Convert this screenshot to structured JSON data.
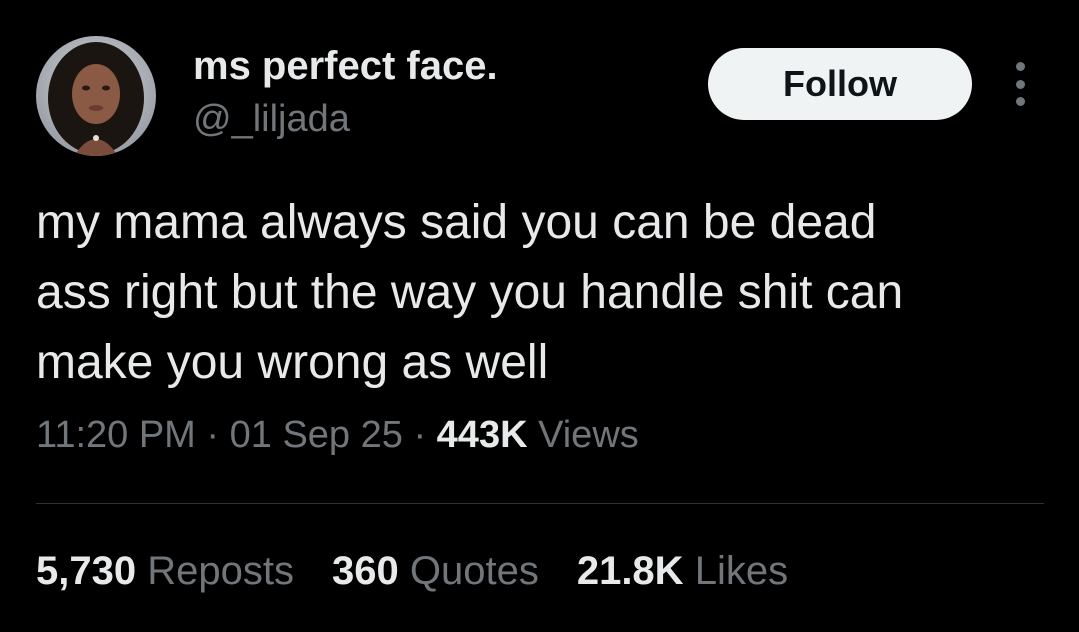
{
  "author": {
    "name": "ms perfect face.",
    "handle": "@_liljada"
  },
  "actions": {
    "follow_label": "Follow",
    "more_icon": "ellipsis-vertical-icon"
  },
  "tweet": {
    "lines": [
      "my mama always said you can be dead",
      "ass right but the way you handle shit can",
      "make you wrong as well"
    ]
  },
  "meta": {
    "time": "11:20 PM",
    "separator": "·",
    "date": "01 Sep 25",
    "views_count": "443K",
    "views_label": "Views"
  },
  "stats": {
    "reposts_count": "5,730",
    "reposts_label": "Reposts",
    "quotes_count": "360",
    "quotes_label": "Quotes",
    "likes_count": "21.8K",
    "likes_label": "Likes"
  },
  "colors": {
    "background": "#000000",
    "primary_text": "#e7e9ea",
    "secondary_text": "#71767b",
    "follow_button_bg": "#eff3f4",
    "divider": "#2f3336"
  }
}
